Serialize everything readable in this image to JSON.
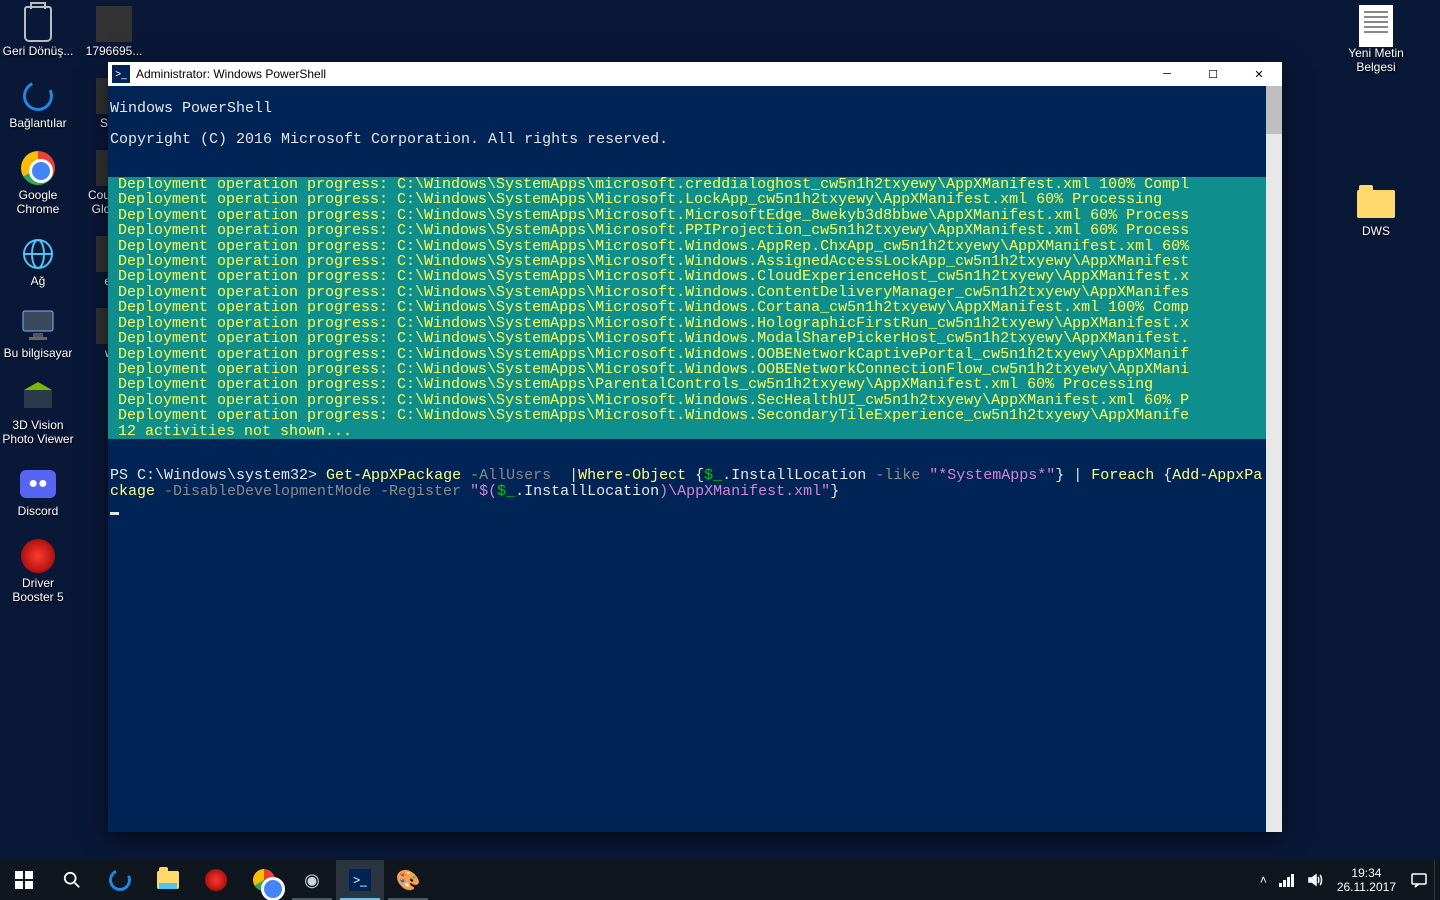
{
  "desktop": {
    "left1": [
      {
        "label": "Geri Dönüş...",
        "icon": "bin"
      },
      {
        "label": "Bağlantılar",
        "icon": "edge"
      },
      {
        "label": "Google Chrome",
        "icon": "chrome"
      },
      {
        "label": "Ağ",
        "icon": "net"
      },
      {
        "label": "Bu bilgisayar",
        "icon": "pc"
      },
      {
        "label": "3D Vision Photo Viewer",
        "icon": "3dv"
      },
      {
        "label": "Discord",
        "icon": "discord"
      },
      {
        "label": "Driver Booster 5",
        "icon": "db"
      }
    ],
    "left2": [
      {
        "label": "1796695..."
      },
      {
        "label": "Ste..."
      },
      {
        "label": "Counter... Global..."
      },
      {
        "label": "el..."
      },
      {
        "label": "w..."
      }
    ],
    "right": [
      {
        "label": "Yeni Metin Belgesi",
        "icon": "doc"
      },
      {
        "label": "DWS",
        "icon": "folder"
      }
    ]
  },
  "window": {
    "title": "Administrator: Windows PowerShell",
    "header1": "Windows PowerShell",
    "header2": "Copyright (C) 2016 Microsoft Corporation. All rights reserved.",
    "progress": [
      "Deployment operation progress: C:\\Windows\\SystemApps\\microsoft.creddialoghost_cw5n1h2txyewy\\AppXManifest.xml 100% Compl",
      "Deployment operation progress: C:\\Windows\\SystemApps\\Microsoft.LockApp_cw5n1h2txyewy\\AppXManifest.xml 60% Processing",
      "Deployment operation progress: C:\\Windows\\SystemApps\\Microsoft.MicrosoftEdge_8wekyb3d8bbwe\\AppXManifest.xml 60% Process",
      "Deployment operation progress: C:\\Windows\\SystemApps\\Microsoft.PPIProjection_cw5n1h2txyewy\\AppXManifest.xml 60% Process",
      "Deployment operation progress: C:\\Windows\\SystemApps\\Microsoft.Windows.AppRep.ChxApp_cw5n1h2txyewy\\AppXManifest.xml 60%",
      "Deployment operation progress: C:\\Windows\\SystemApps\\Microsoft.Windows.AssignedAccessLockApp_cw5n1h2txyewy\\AppXManifest",
      "Deployment operation progress: C:\\Windows\\SystemApps\\Microsoft.Windows.CloudExperienceHost_cw5n1h2txyewy\\AppXManifest.x",
      "Deployment operation progress: C:\\Windows\\SystemApps\\Microsoft.Windows.ContentDeliveryManager_cw5n1h2txyewy\\AppXManifes",
      "Deployment operation progress: C:\\Windows\\SystemApps\\Microsoft.Windows.Cortana_cw5n1h2txyewy\\AppXManifest.xml 100% Comp",
      "Deployment operation progress: C:\\Windows\\SystemApps\\Microsoft.Windows.HolographicFirstRun_cw5n1h2txyewy\\AppXManifest.x",
      "Deployment operation progress: C:\\Windows\\SystemApps\\Microsoft.Windows.ModalSharePickerHost_cw5n1h2txyewy\\AppXManifest.",
      "Deployment operation progress: C:\\Windows\\SystemApps\\Microsoft.Windows.OOBENetworkCaptivePortal_cw5n1h2txyewy\\AppXManif",
      "Deployment operation progress: C:\\Windows\\SystemApps\\Microsoft.Windows.OOBENetworkConnectionFlow_cw5n1h2txyewy\\AppXMani",
      "Deployment operation progress: C:\\Windows\\SystemApps\\ParentalControls_cw5n1h2txyewy\\AppXManifest.xml 60% Processing",
      "Deployment operation progress: C:\\Windows\\SystemApps\\Microsoft.Windows.SecHealthUI_cw5n1h2txyewy\\AppXManifest.xml 60% P",
      "Deployment operation progress: C:\\Windows\\SystemApps\\Microsoft.Windows.SecondaryTileExperience_cw5n1h2txyewy\\AppXManife",
      "12 activities not shown..."
    ],
    "cmd": {
      "prompt": "PS C:\\Windows\\system32> ",
      "p1": "Get-AppXPackage ",
      "p2": "-AllUsers ",
      "p3": " |",
      "p4": "Where-Object ",
      "p5": "{",
      "p6": "$_",
      "p7": ".InstallLocation ",
      "p8": "-like ",
      "p9": "\"*SystemApps*\"",
      "p10": "} | ",
      "p11": "Foreach ",
      "p12": "{",
      "p13": "Add-AppxPackage ",
      "p14": "-DisableDevelopmentMode -Register ",
      "p15": "\"$(",
      "p16": "$_",
      "p17": ".InstallLocation",
      "p18": ")",
      "p19": "\\AppXManifest.xml\"",
      "p20": "}"
    }
  },
  "taskbar": {
    "time": "19:34",
    "date": "26.11.2017"
  }
}
